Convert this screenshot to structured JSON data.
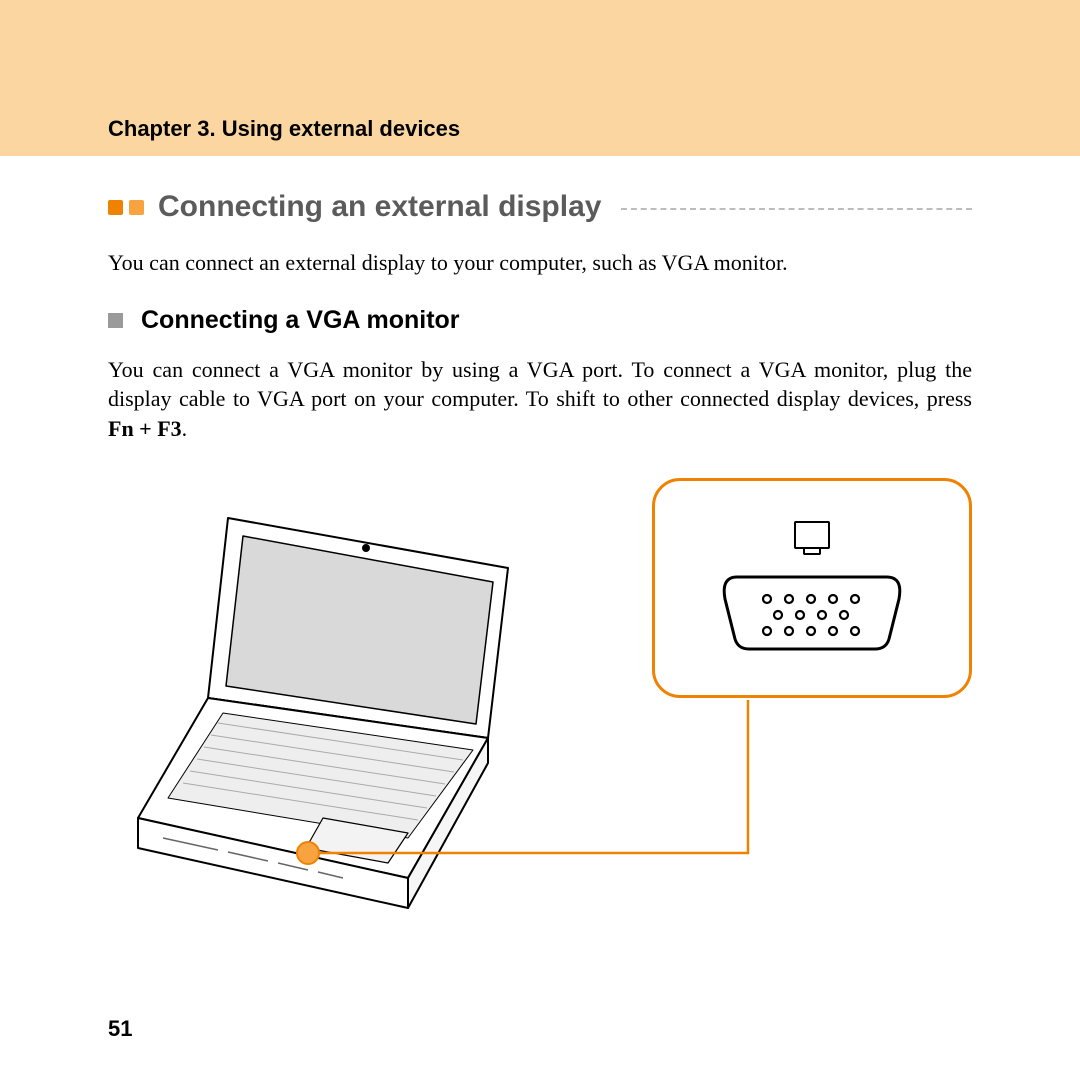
{
  "chapter": "Chapter 3. Using external devices",
  "h1": "Connecting an external display",
  "intro": "You can connect an external display to your computer, such as VGA monitor.",
  "h2": "Connecting a VGA monitor",
  "body_pre": "You can connect a VGA monitor by using a VGA port. To connect a VGA monitor, plug the display cable to VGA port on your computer. To shift to other connected display devices, press ",
  "body_bold": "Fn + F3",
  "body_post": ".",
  "page_number": "51",
  "icons": {
    "bullet_primary": "orange-square-icon",
    "bullet_secondary": "grey-square-icon",
    "callout_monitor": "monitor-icon",
    "callout_port": "vga-port-icon",
    "laptop": "laptop-illustration"
  },
  "colors": {
    "header_band": "#fbd6a0",
    "accent": "#ef8200",
    "h1_text": "#5b5b5b"
  }
}
